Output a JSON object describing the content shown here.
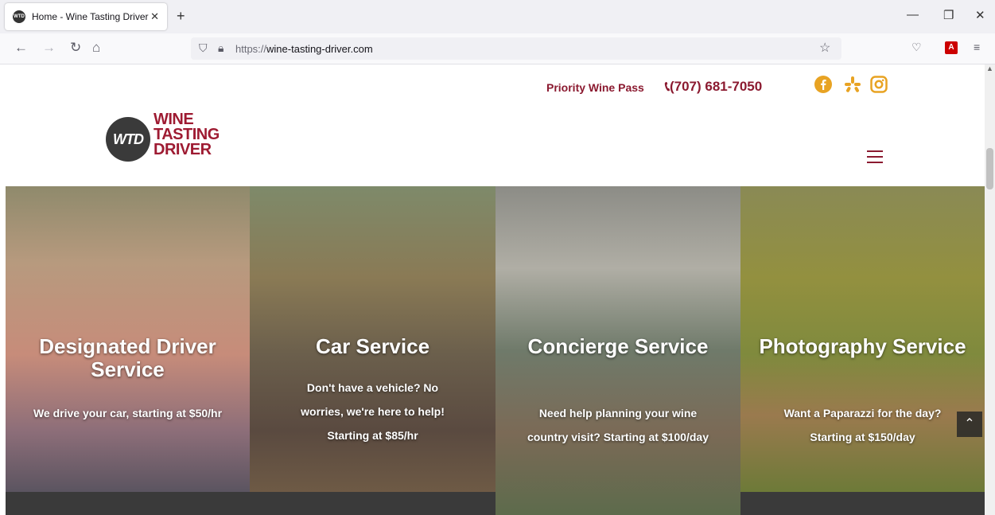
{
  "browser": {
    "tab_title": "Home - Wine Tasting Driver",
    "tab_favicon_text": "WTD",
    "tab_close": "✕",
    "new_tab": "+",
    "url_scheme": "https://",
    "url_host": "wine-tasting-driver.com",
    "window_controls": {
      "minimize": "—",
      "restore": "❐",
      "close": "✕"
    }
  },
  "header": {
    "priority_link": "Priority Wine Pass",
    "phone": "(707) 681-7050",
    "social_icons": [
      "facebook-icon",
      "yelp-icon",
      "instagram-icon"
    ],
    "logo": {
      "circle": "WTD",
      "line1": "WINE",
      "line2": "TASTING",
      "line3": "DRIVER"
    },
    "brand_color": "#9e1b32",
    "accent_color": "#e8a323"
  },
  "services": [
    {
      "title": "Designated Driver Service",
      "description": "We drive your car, starting at $50/hr"
    },
    {
      "title": "Car Service",
      "description": "Don't have a vehicle? No worries, we're here to help! Starting at $85/hr"
    },
    {
      "title": "Concierge Service",
      "description": "Need help planning your wine country visit? Starting at $100/day"
    },
    {
      "title": "Photography Service",
      "description": "Want a Paparazzi for the day? Starting at $150/day"
    }
  ]
}
